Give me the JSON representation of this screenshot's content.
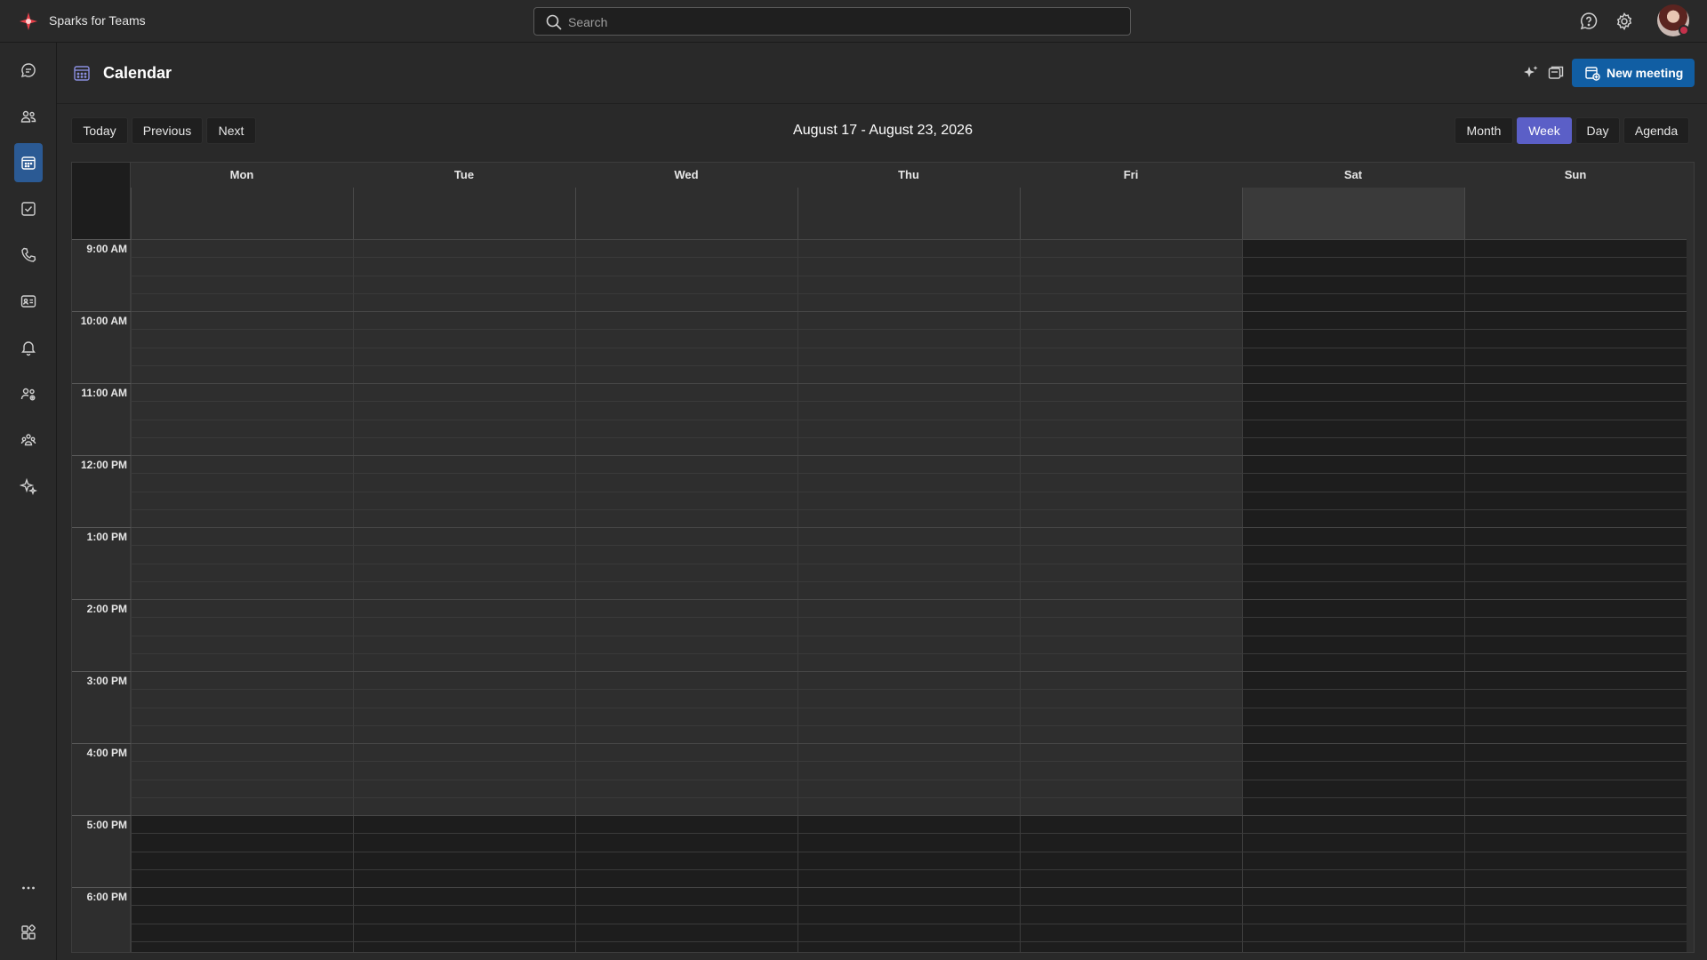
{
  "app": {
    "name": "Sparks for Teams"
  },
  "search": {
    "placeholder": "Search"
  },
  "rail": {
    "items": [
      {
        "name": "chat-icon",
        "active": false
      },
      {
        "name": "teams-icon",
        "active": false
      },
      {
        "name": "calendar-icon",
        "active": true
      },
      {
        "name": "tasks-icon",
        "active": false
      },
      {
        "name": "calls-icon",
        "active": false
      },
      {
        "name": "contact-card-icon",
        "active": false
      },
      {
        "name": "activity-bell-icon",
        "active": false
      },
      {
        "name": "people-settings-icon",
        "active": false
      },
      {
        "name": "communities-icon",
        "active": false
      },
      {
        "name": "sparkle-icon",
        "active": false
      }
    ],
    "bottom": [
      {
        "name": "more-icon"
      },
      {
        "name": "apps-icon"
      }
    ]
  },
  "page": {
    "title": "Calendar"
  },
  "header": {
    "new_meeting_label": "New meeting"
  },
  "toolbar": {
    "today": "Today",
    "previous": "Previous",
    "next": "Next",
    "date_range": "August 17 - August 23, 2026",
    "views": [
      "Month",
      "Week",
      "Day",
      "Agenda"
    ],
    "selected_view": "Week"
  },
  "calendar": {
    "days": [
      "Mon",
      "Tue",
      "Wed",
      "Thu",
      "Fri",
      "Sat",
      "Sun"
    ],
    "times": [
      "9:00 AM",
      "10:00 AM",
      "11:00 AM",
      "12:00 PM",
      "1:00 PM",
      "2:00 PM",
      "3:00 PM",
      "4:00 PM",
      "5:00 PM",
      "6:00 PM"
    ]
  },
  "colors": {
    "accent": "#5b5fc7",
    "primary_button": "#115ea3",
    "rail_active": "#2b5a94",
    "avatar_status": "#c4314b"
  }
}
